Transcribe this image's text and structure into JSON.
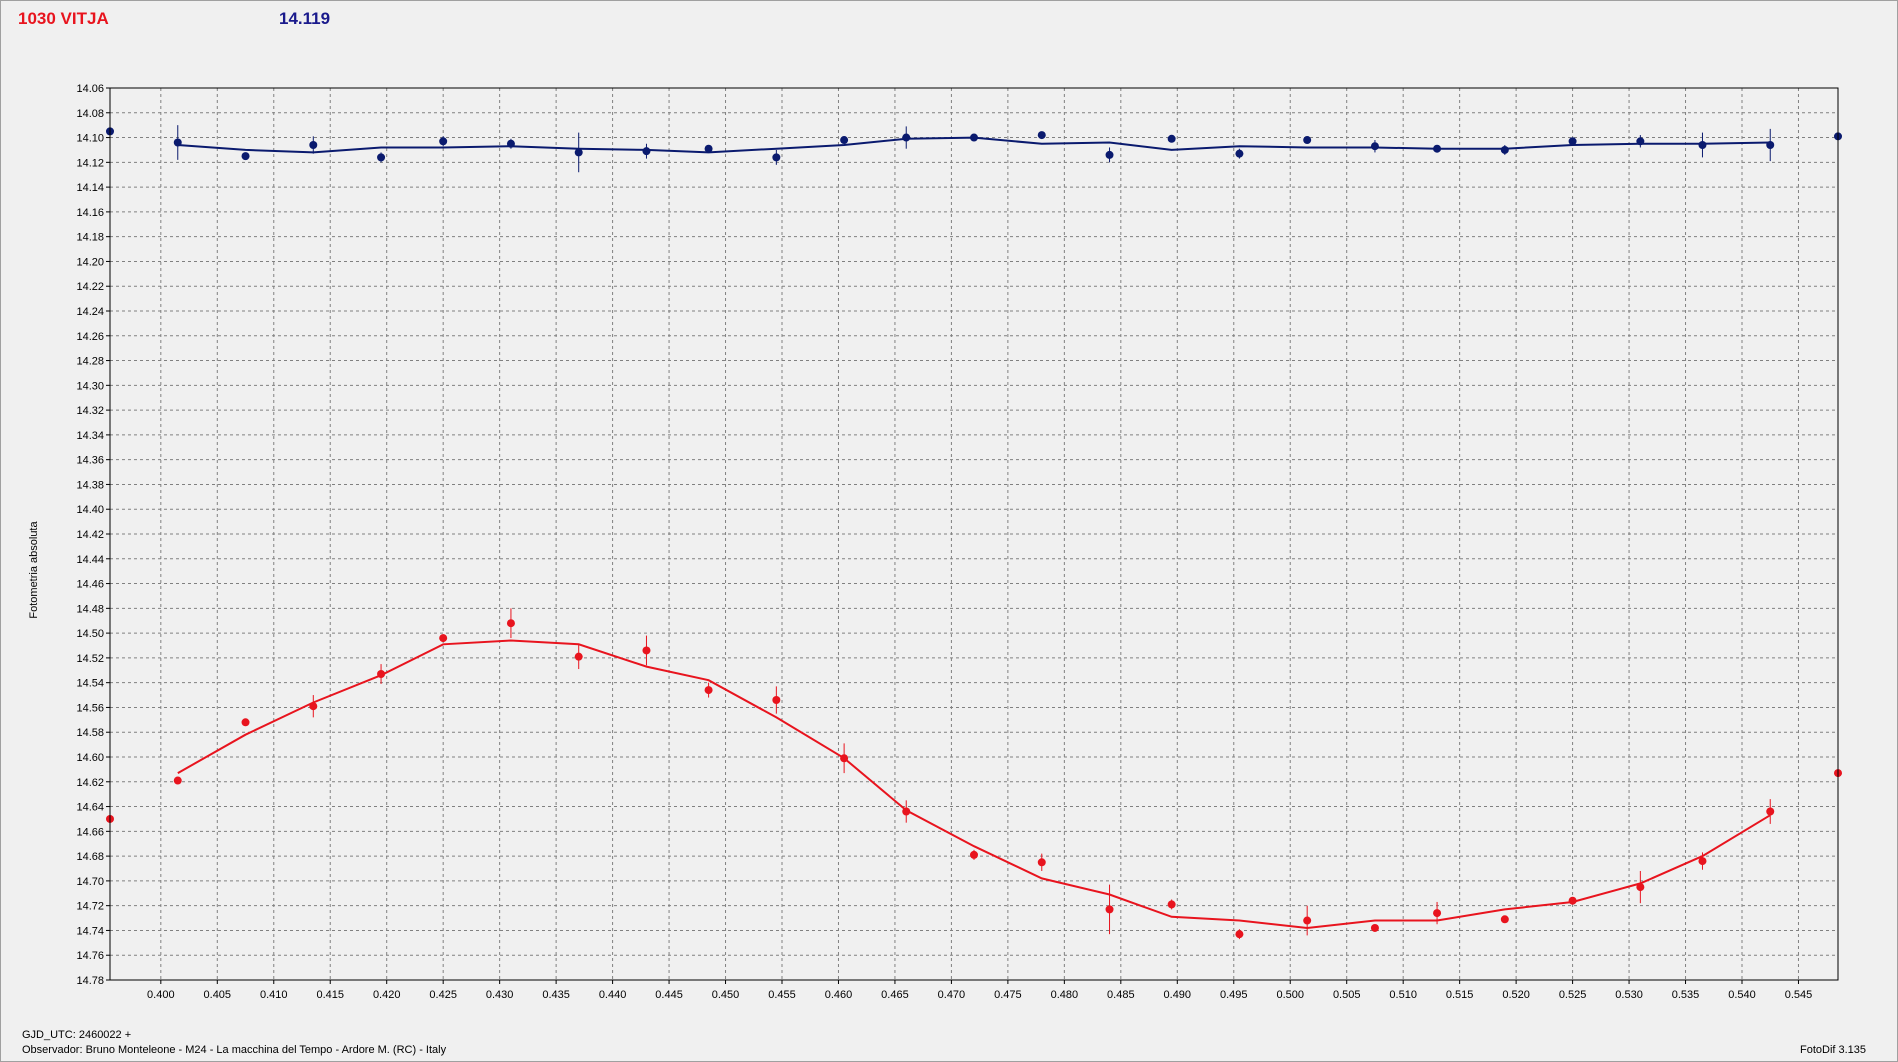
{
  "header": {
    "star_label": "1030 VITJA",
    "comp_label": "14.119"
  },
  "axis": {
    "ylabel": "Fotometria absoluta"
  },
  "footer": {
    "gjd": "GJD_UTC: 2460022 +",
    "observer": "Observador: Bruno Monteleone - M24 - La macchina del Tempo - Ardore M. (RC) - Italy",
    "software": "FotoDif 3.135"
  },
  "colors": {
    "star": "#e8141e",
    "comparison": "#0a1a6e",
    "plot_bg": "#f0f0f0",
    "grid": "#808080"
  },
  "chart_data": {
    "type": "scatter",
    "xlim": [
      0.3955,
      0.5485
    ],
    "ylim": [
      14.78,
      14.06
    ],
    "y_inverted": true,
    "grid": true,
    "x_ticks": [
      0.4,
      0.405,
      0.41,
      0.415,
      0.42,
      0.425,
      0.43,
      0.435,
      0.44,
      0.445,
      0.45,
      0.455,
      0.46,
      0.465,
      0.47,
      0.475,
      0.48,
      0.485,
      0.49,
      0.495,
      0.5,
      0.505,
      0.51,
      0.515,
      0.52,
      0.525,
      0.53,
      0.535,
      0.54,
      0.545
    ],
    "y_ticks": [
      14.06,
      14.08,
      14.1,
      14.12,
      14.14,
      14.16,
      14.18,
      14.2,
      14.22,
      14.24,
      14.26,
      14.28,
      14.3,
      14.32,
      14.34,
      14.36,
      14.38,
      14.4,
      14.42,
      14.44,
      14.46,
      14.48,
      14.5,
      14.52,
      14.54,
      14.56,
      14.58,
      14.6,
      14.62,
      14.64,
      14.66,
      14.68,
      14.7,
      14.72,
      14.74,
      14.76,
      14.78
    ],
    "series": [
      {
        "color": "#e8141e",
        "x": [
          0.3955,
          0.4015,
          0.4075,
          0.4135,
          0.4195,
          0.425,
          0.431,
          0.437,
          0.443,
          0.4485,
          0.4545,
          0.4605,
          0.466,
          0.472,
          0.478,
          0.484,
          0.4895,
          0.4955,
          0.5015,
          0.5075,
          0.513,
          0.519,
          0.525,
          0.531,
          0.5365,
          0.5425,
          0.5485
        ],
        "y": [
          14.65,
          14.619,
          14.572,
          14.559,
          14.533,
          14.504,
          14.492,
          14.519,
          14.514,
          14.546,
          14.554,
          14.601,
          14.644,
          14.679,
          14.685,
          14.723,
          14.719,
          14.743,
          14.732,
          14.738,
          14.726,
          14.731,
          14.716,
          14.705,
          14.684,
          14.644,
          14.613
        ],
        "err": [
          0.034,
          0.002,
          0.003,
          0.009,
          0.008,
          0.003,
          0.012,
          0.01,
          0.012,
          0.006,
          0.011,
          0.012,
          0.009,
          0.004,
          0.007,
          0.02,
          0.004,
          0.004,
          0.012,
          0.002,
          0.009,
          0.003,
          0.002,
          0.013,
          0.007,
          0.01,
          0.002
        ],
        "fit_x": [
          0.4015,
          0.4075,
          0.4135,
          0.4195,
          0.425,
          0.431,
          0.437,
          0.443,
          0.4485,
          0.4545,
          0.4605,
          0.466,
          0.472,
          0.478,
          0.484,
          0.4895,
          0.4955,
          0.5015,
          0.5075,
          0.513,
          0.519,
          0.525,
          0.531,
          0.5365,
          0.5425
        ],
        "fit_y": [
          14.613,
          14.582,
          14.556,
          14.534,
          14.509,
          14.506,
          14.509,
          14.527,
          14.538,
          14.568,
          14.601,
          14.643,
          14.672,
          14.698,
          14.711,
          14.729,
          14.732,
          14.738,
          14.732,
          14.732,
          14.723,
          14.717,
          14.702,
          14.68,
          14.647
        ]
      },
      {
        "color": "#0a1a6e",
        "x": [
          0.3955,
          0.4015,
          0.4075,
          0.4135,
          0.4195,
          0.425,
          0.431,
          0.437,
          0.443,
          0.4485,
          0.4545,
          0.4605,
          0.466,
          0.472,
          0.478,
          0.484,
          0.4895,
          0.4955,
          0.5015,
          0.5075,
          0.513,
          0.519,
          0.525,
          0.531,
          0.5365,
          0.5425,
          0.5485
        ],
        "y": [
          14.095,
          14.104,
          14.115,
          14.106,
          14.116,
          14.103,
          14.105,
          14.112,
          14.111,
          14.109,
          14.116,
          14.102,
          14.1,
          14.1,
          14.098,
          14.114,
          14.101,
          14.113,
          14.102,
          14.107,
          14.109,
          14.11,
          14.103,
          14.103,
          14.106,
          14.106,
          14.099
        ],
        "err": [
          0.002,
          0.014,
          0.002,
          0.007,
          0.004,
          0.004,
          0.004,
          0.016,
          0.006,
          0.003,
          0.006,
          0.003,
          0.009,
          0.003,
          0.002,
          0.006,
          0.002,
          0.004,
          0.002,
          0.005,
          0.002,
          0.004,
          0.003,
          0.005,
          0.01,
          0.013,
          0.003
        ],
        "fit_x": [
          0.4015,
          0.4075,
          0.4135,
          0.4195,
          0.425,
          0.431,
          0.437,
          0.443,
          0.4485,
          0.4545,
          0.4605,
          0.466,
          0.472,
          0.478,
          0.484,
          0.4895,
          0.4955,
          0.5015,
          0.5075,
          0.513,
          0.519,
          0.525,
          0.531,
          0.5365,
          0.5425
        ],
        "fit_y": [
          14.106,
          14.11,
          14.112,
          14.108,
          14.108,
          14.107,
          14.109,
          14.11,
          14.112,
          14.109,
          14.106,
          14.101,
          14.1,
          14.105,
          14.104,
          14.11,
          14.107,
          14.108,
          14.108,
          14.109,
          14.109,
          14.106,
          14.105,
          14.105,
          14.104
        ]
      }
    ]
  }
}
